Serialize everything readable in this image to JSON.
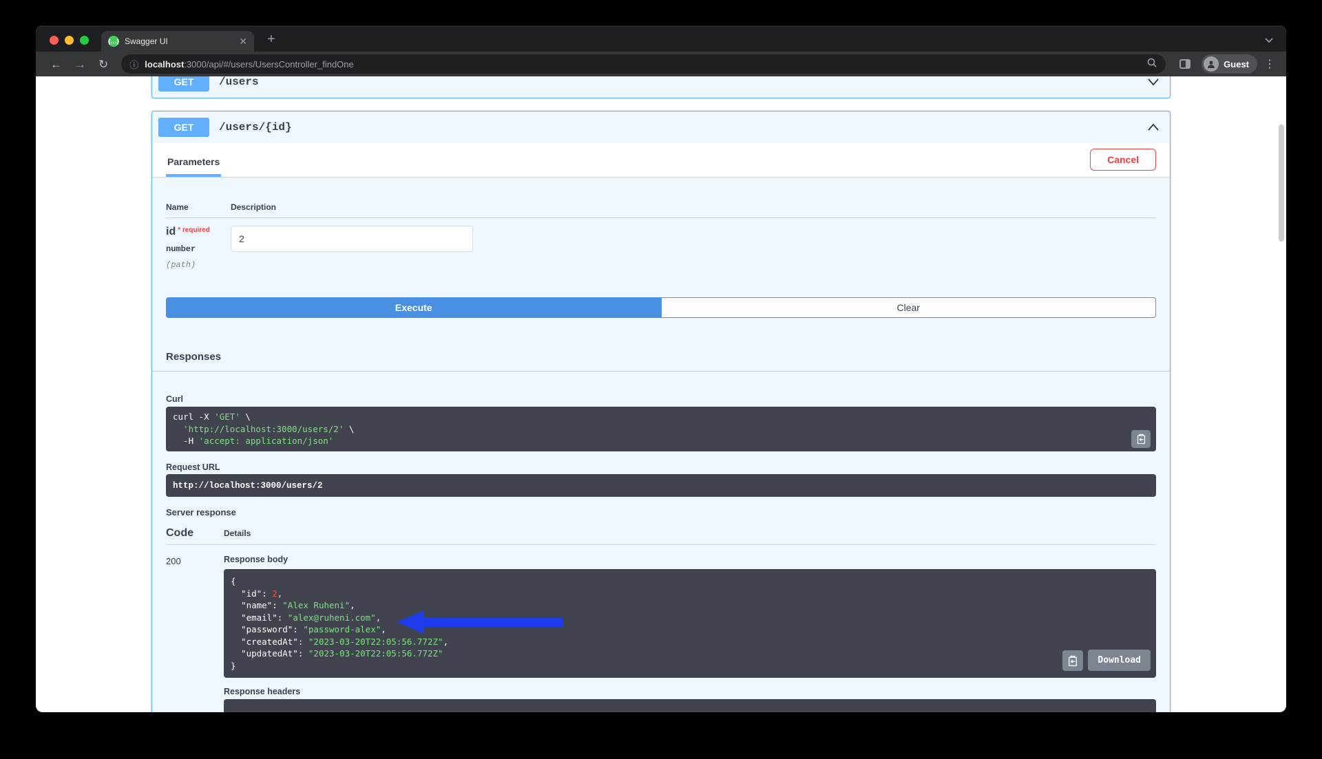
{
  "browser": {
    "tab_title": "Swagger UI",
    "url_host": "localhost",
    "url_rest": ":3000/api/#/users/UsersController_findOne",
    "profile_label": "Guest"
  },
  "operations": {
    "collapsed": {
      "method": "GET",
      "path": "/users"
    },
    "expanded": {
      "method": "GET",
      "path": "/users/{id}"
    }
  },
  "panel": {
    "tab_label": "Parameters",
    "cancel_label": "Cancel",
    "col_name": "Name",
    "col_description": "Description",
    "param": {
      "name": "id",
      "required": "* required",
      "type": "number",
      "location": "(path)",
      "value": "2"
    },
    "execute_label": "Execute",
    "clear_label": "Clear"
  },
  "responses": {
    "heading": "Responses",
    "curl_label": "Curl",
    "request_url_label": "Request URL",
    "request_url": "http://localhost:3000/users/2",
    "server_response_label": "Server response",
    "code_col": "Code",
    "details_col": "Details",
    "status_code": "200",
    "response_body_label": "Response body",
    "download_label": "Download",
    "response_headers_label": "Response headers"
  },
  "curl_code": [
    [
      [
        "curl -X ",
        "p"
      ],
      [
        "'GET'",
        "s"
      ],
      [
        " \\",
        "p"
      ]
    ],
    [
      [
        "  ",
        "p"
      ],
      [
        "'http://localhost:3000/users/2'",
        "s"
      ],
      [
        " \\",
        "p"
      ]
    ],
    [
      [
        "  -H ",
        "p"
      ],
      [
        "'accept: application/json'",
        "s"
      ]
    ]
  ],
  "body_code": [
    [
      [
        "{",
        "p"
      ]
    ],
    [
      [
        "  \"id\": ",
        "p"
      ],
      [
        "2",
        "n"
      ],
      [
        ",",
        "p"
      ]
    ],
    [
      [
        "  \"name\": ",
        "p"
      ],
      [
        "\"Alex Ruheni\"",
        "s"
      ],
      [
        ",",
        "p"
      ]
    ],
    [
      [
        "  \"email\": ",
        "p"
      ],
      [
        "\"alex@ruheni.com\"",
        "s"
      ],
      [
        ",",
        "p"
      ]
    ],
    [
      [
        "  \"password\": ",
        "p"
      ],
      [
        "\"password-alex\"",
        "s"
      ],
      [
        ",",
        "p"
      ]
    ],
    [
      [
        "  \"createdAt\": ",
        "p"
      ],
      [
        "\"2023-03-20T22:05:56.772Z\"",
        "s"
      ],
      [
        ",",
        "p"
      ]
    ],
    [
      [
        "  \"updatedAt\": ",
        "p"
      ],
      [
        "\"2023-03-20T22:05:56.772Z\"",
        "s"
      ]
    ],
    [
      [
        "}",
        "p"
      ]
    ]
  ],
  "annotation": {
    "type": "arrow-left",
    "color": "#1e3ceb",
    "points_at": "password line"
  },
  "colors": {
    "method_badge": "#61affe",
    "opblock_border": "#61affe",
    "execute_button": "#4990e2",
    "cancel_red": "#f23f3f",
    "code_background": "#41444e",
    "code_string_green": "#7ee081",
    "code_number_red": "#e5534b"
  }
}
